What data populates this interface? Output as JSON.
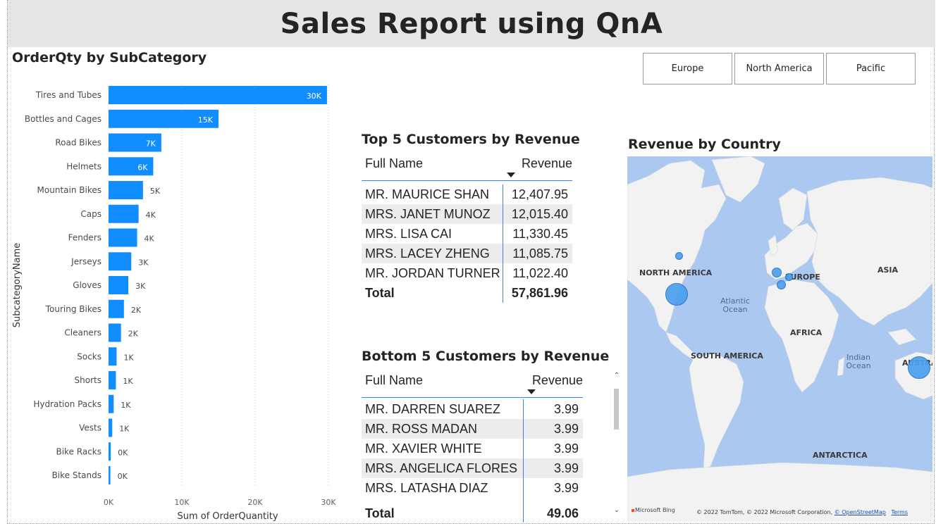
{
  "header": {
    "title": "Sales Report using QnA"
  },
  "bar_visual": {
    "title": "OrderQty by SubCategory"
  },
  "chart_data": {
    "type": "bar",
    "orientation": "horizontal",
    "title": "OrderQty by SubCategory",
    "xlabel": "Sum of OrderQuantity",
    "ylabel": "SubcategoryName",
    "xlim": [
      0,
      30000
    ],
    "x_ticks": [
      "0K",
      "10K",
      "20K",
      "30K"
    ],
    "x_tick_values": [
      0,
      10000,
      20000,
      30000
    ],
    "grid": "vertical dotted",
    "color": "#118dff",
    "categories": [
      "Tires and Tubes",
      "Bottles and Cages",
      "Road Bikes",
      "Helmets",
      "Mountain Bikes",
      "Caps",
      "Fenders",
      "Jerseys",
      "Gloves",
      "Touring Bikes",
      "Cleaners",
      "Socks",
      "Shorts",
      "Hydration Packs",
      "Vests",
      "Bike Racks",
      "Bike Stands"
    ],
    "values": [
      29800,
      15000,
      7200,
      6100,
      4700,
      4100,
      3900,
      3100,
      2700,
      2100,
      1700,
      1100,
      1000,
      700,
      500,
      300,
      250
    ],
    "data_labels": [
      "30K",
      "15K",
      "7K",
      "6K",
      "5K",
      "4K",
      "4K",
      "3K",
      "3K",
      "2K",
      "2K",
      "1K",
      "1K",
      "1K",
      "1K",
      "0K",
      "0K"
    ]
  },
  "slicer": {
    "options": [
      "Europe",
      "North America",
      "Pacific"
    ]
  },
  "top5": {
    "title": "Top 5 Customers by Revenue",
    "col_name": "Full Name",
    "col_revenue": "Revenue",
    "rows": [
      {
        "name": "MR. MAURICE SHAN",
        "revenue": "12,407.95"
      },
      {
        "name": "MRS. JANET MUNOZ",
        "revenue": "12,015.40"
      },
      {
        "name": "MRS. LISA CAI",
        "revenue": "11,330.45"
      },
      {
        "name": "MRS. LACEY ZHENG",
        "revenue": "11,085.75"
      },
      {
        "name": "MR. JORDAN TURNER",
        "revenue": "11,022.40"
      }
    ],
    "total_label": "Total",
    "total_value": "57,861.96"
  },
  "bottom5": {
    "title": "Bottom 5 Customers by Revenue",
    "col_name": "Full Name",
    "col_revenue": "Revenue",
    "rows": [
      {
        "name": "MR. DARREN SUAREZ",
        "revenue": "3.99"
      },
      {
        "name": "MR. ROSS MADAN",
        "revenue": "3.99"
      },
      {
        "name": "MR. XAVIER WHITE",
        "revenue": "3.99"
      },
      {
        "name": "MRS. ANGELICA FLORES",
        "revenue": "3.99"
      },
      {
        "name": "MRS. LATASHA DIAZ",
        "revenue": "3.99"
      }
    ],
    "total_label": "Total",
    "total_value": "49.06"
  },
  "map": {
    "title": "Revenue by Country",
    "labels": {
      "north_america": "NORTH AMERICA",
      "europe": "EUROPE",
      "asia": "ASIA",
      "africa": "AFRICA",
      "south_america": "SOUTH AMERICA",
      "antarctica": "ANTARCTICA",
      "australia": "AUSTRA",
      "atlantic": "Atlantic Ocean",
      "indian": "Indian Ocean"
    },
    "bing": "Microsoft Bing",
    "attribution": "© 2022 TomTom, © 2022 Microsoft Corporation, ",
    "osm_link": "© OpenStreetMap",
    "terms_link": "Terms",
    "colors": {
      "water": "#aac8f0",
      "land": "#f2f2f2",
      "bubble": "#4aa0f0"
    }
  }
}
